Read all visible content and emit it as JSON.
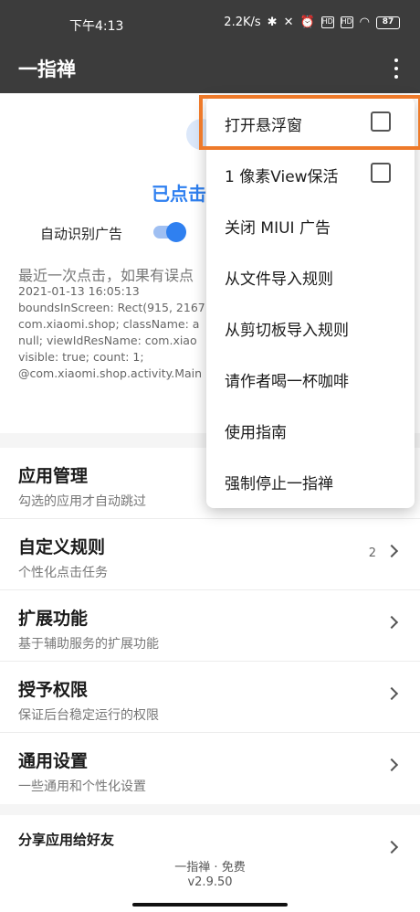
{
  "status_bar": {
    "time": "下午4:13",
    "network_speed": "2.2K/s",
    "battery": "87",
    "signal1": "HD",
    "signal2": "HD"
  },
  "app_bar": {
    "title": "一指禅",
    "menu_icon": "more-vert-icon"
  },
  "status": {
    "clicked_text": "已点击",
    "auto_detect_label": "自动识别广告",
    "auto_detect_enabled": true
  },
  "last_click": {
    "header": "最近一次点击，如果有误点",
    "lines": [
      "2021-01-13 16:05:13",
      "boundsInScreen: Rect(915, 2167",
      "com.xiaomi.shop; className: a",
      "null; viewIdResName: com.xiao",
      "visible: true; count: 1;",
      "@com.xiaomi.shop.activity.Main"
    ]
  },
  "list": [
    {
      "title": "应用管理",
      "subtitle": "勾选的应用才自动跳过",
      "count": ""
    },
    {
      "title": "自定义规则",
      "subtitle": "个性化点击任务",
      "count": "2"
    },
    {
      "title": "扩展功能",
      "subtitle": "基于辅助服务的扩展功能",
      "count": ""
    },
    {
      "title": "授予权限",
      "subtitle": "保证后台稳定运行的权限",
      "count": ""
    },
    {
      "title": "通用设置",
      "subtitle": "一些通用和个性化设置",
      "count": ""
    }
  ],
  "share": {
    "title": "分享应用给好友"
  },
  "footer": {
    "app_name_price": "一指禅 · 免费",
    "version": "v2.9.50"
  },
  "menu": {
    "items": [
      {
        "label": "打开悬浮窗",
        "checkbox": true,
        "checked": false
      },
      {
        "label": "1 像素View保活",
        "checkbox": true,
        "checked": false
      },
      {
        "label": "关闭 MIUI 广告"
      },
      {
        "label": "从文件导入规则"
      },
      {
        "label": "从剪切板导入规则"
      },
      {
        "label": "请作者喝一杯咖啡"
      },
      {
        "label": "使用指南"
      },
      {
        "label": "强制停止一指禅"
      }
    ]
  },
  "colors": {
    "accent": "#2f80f0",
    "highlight": "#ee7a2a",
    "appbar": "#3c3c3c"
  }
}
